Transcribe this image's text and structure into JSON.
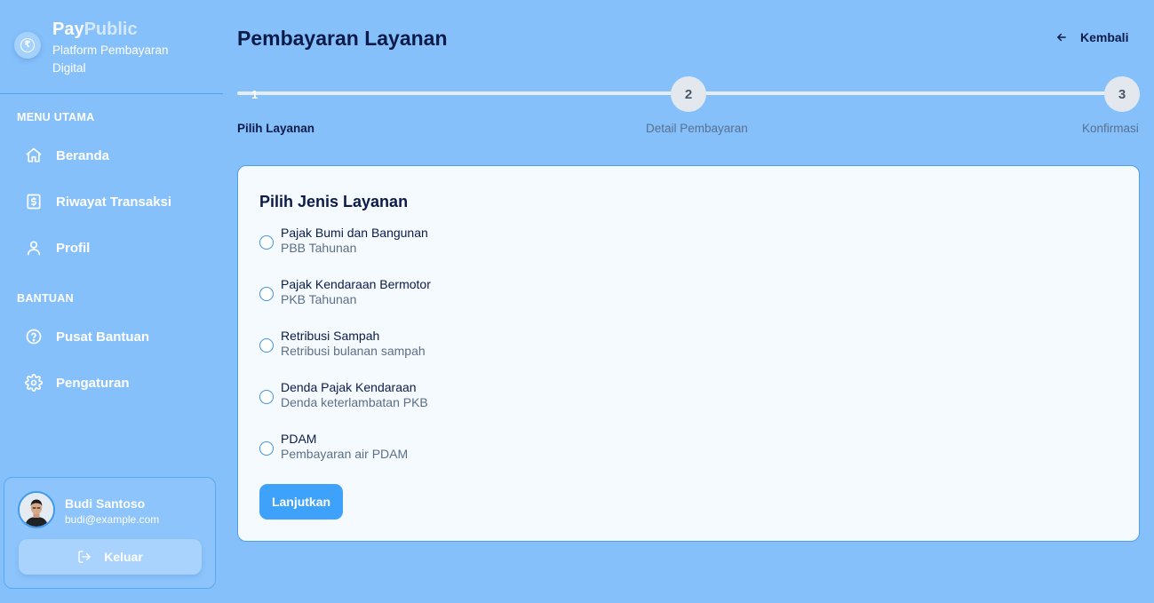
{
  "brand": {
    "name_part1": "Pay",
    "name_part2": "Public",
    "subtitle": "Platform Pembayaran Digital",
    "icon": "rupee-coin-icon"
  },
  "sidebar": {
    "sections": [
      {
        "title": "MENU UTAMA"
      },
      {
        "title": "BANTUAN"
      }
    ],
    "items": [
      {
        "label": "Beranda",
        "icon": "home-icon"
      },
      {
        "label": "Riwayat Transaksi",
        "icon": "receipt-icon"
      },
      {
        "label": "Profil",
        "icon": "user-icon"
      },
      {
        "label": "Pusat Bantuan",
        "icon": "help-circle-icon"
      },
      {
        "label": "Pengaturan",
        "icon": "gear-icon"
      }
    ]
  },
  "user": {
    "name": "Budi Santoso",
    "email": "budi@example.com",
    "logout_label": "Keluar"
  },
  "header": {
    "title": "Pembayaran Layanan",
    "back_label": "Kembali"
  },
  "stepper": {
    "steps": [
      {
        "number": "1",
        "label": "Pilih Layanan",
        "active": true
      },
      {
        "number": "2",
        "label": "Detail Pembayaran",
        "active": false
      },
      {
        "number": "3",
        "label": "Konfirmasi",
        "active": false
      }
    ]
  },
  "form": {
    "title": "Pilih Jenis Layanan",
    "options": [
      {
        "label": "Pajak Bumi dan Bangunan",
        "sub": "PBB Tahunan",
        "selected": false
      },
      {
        "label": "Pajak Kendaraan Bermotor",
        "sub": "PKB Tahunan",
        "selected": false
      },
      {
        "label": "Retribusi Sampah",
        "sub": "Retribusi bulanan sampah",
        "selected": false
      },
      {
        "label": "Denda Pajak Kendaraan",
        "sub": "Denda keterlambatan PKB",
        "selected": false
      },
      {
        "label": "PDAM",
        "sub": "Pembayaran air PDAM",
        "selected": false
      }
    ],
    "submit_label": "Lanjutkan"
  },
  "colors": {
    "background": "#86c0fb",
    "card": "#f5faff",
    "primary_button": "#3ea2fa",
    "heading": "#0c1b48"
  }
}
